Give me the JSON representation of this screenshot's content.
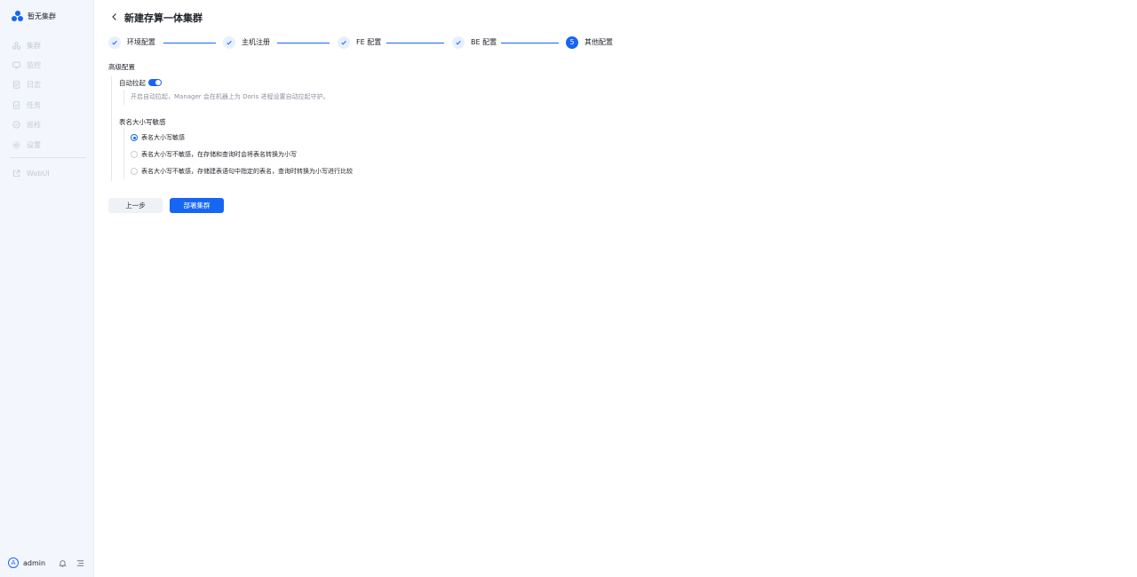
{
  "sidebar": {
    "brand": "暂无集群",
    "items": [
      {
        "label": "集群",
        "icon": "cluster-icon"
      },
      {
        "label": "监控",
        "icon": "monitor-icon"
      },
      {
        "label": "日志",
        "icon": "log-icon"
      },
      {
        "label": "任务",
        "icon": "task-icon"
      },
      {
        "label": "巡检",
        "icon": "inspection-icon"
      },
      {
        "label": "设置",
        "icon": "gear-icon"
      }
    ],
    "webui": {
      "label": "WebUI",
      "icon": "external-link-icon"
    },
    "user": {
      "avatar_letter": "A",
      "name": "admin"
    }
  },
  "header": {
    "title": "新建存算一体集群"
  },
  "steps": [
    {
      "label": "环境配置",
      "status": "done"
    },
    {
      "label": "主机注册",
      "status": "done"
    },
    {
      "label": "FE 配置",
      "status": "done"
    },
    {
      "label": "BE 配置",
      "status": "done"
    },
    {
      "label": "其他配置",
      "status": "active",
      "number": "5"
    }
  ],
  "advanced": {
    "title": "高级配置",
    "auto_restart": {
      "label": "自动拉起",
      "enabled": true,
      "description": "开启自动拉起，Manager 会在机器上为 Doris 进程设置自动拉起守护。"
    },
    "case_sensitivity": {
      "title": "表名大小写敏感",
      "options": [
        {
          "label": "表名大小写敏感",
          "checked": true
        },
        {
          "label": "表名大小写不敏感，在存储和查询时会将表名转换为小写",
          "checked": false
        },
        {
          "label": "表名大小写不敏感，存储建表语句中指定的表名，查询时转换为小写进行比较",
          "checked": false
        }
      ]
    }
  },
  "actions": {
    "prev": "上一步",
    "deploy": "部署集群"
  },
  "colors": {
    "accent": "#1666f4",
    "sidebar_bg": "#f3f6fc"
  }
}
